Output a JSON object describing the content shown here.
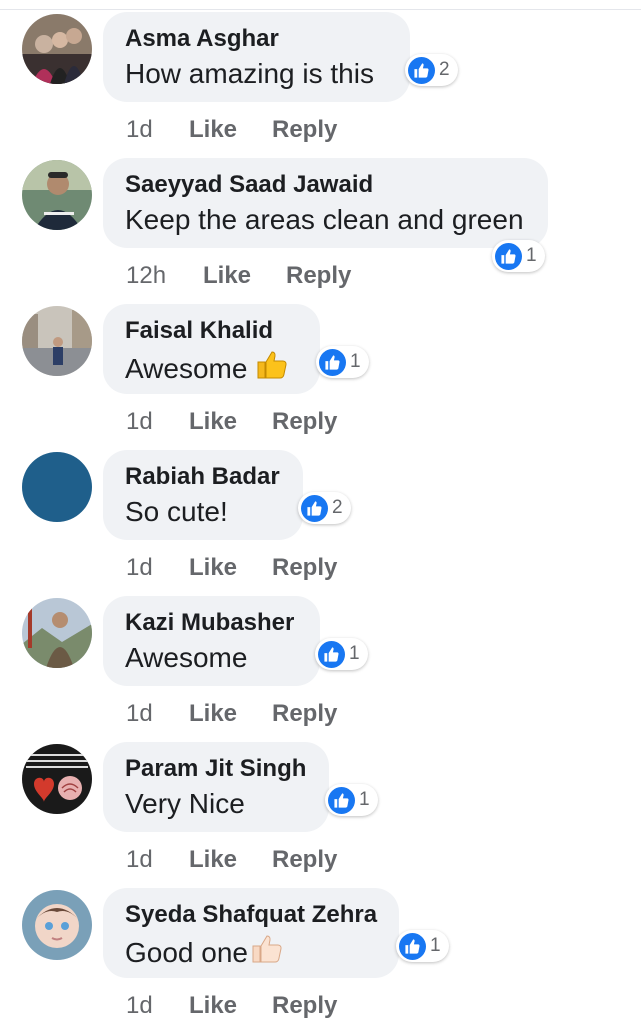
{
  "actions": {
    "like_label": "Like",
    "reply_label": "Reply"
  },
  "colors": {
    "like_badge": "#1877f2",
    "bubble": "#f0f2f5",
    "meta_text": "#65676b"
  },
  "comments": [
    {
      "author": "Asma Asghar",
      "text": "How amazing is this",
      "emoji": "",
      "time": "1d",
      "reaction_count": "2",
      "reaction_icon": "like-icon"
    },
    {
      "author": "Saeyyad Saad Jawaid",
      "text": "Keep the areas clean and green",
      "emoji": "",
      "time": "12h",
      "reaction_count": "1",
      "reaction_icon": "like-icon"
    },
    {
      "author": "Faisal Khalid",
      "text": "Awesome",
      "emoji": "thumbs-up",
      "time": "1d",
      "reaction_count": "1",
      "reaction_icon": "like-icon"
    },
    {
      "author": "Rabiah Badar",
      "text": "So cute!",
      "emoji": "",
      "time": "1d",
      "reaction_count": "2",
      "reaction_icon": "like-icon"
    },
    {
      "author": "Kazi Mubasher",
      "text": "Awesome",
      "emoji": "",
      "time": "1d",
      "reaction_count": "1",
      "reaction_icon": "like-icon"
    },
    {
      "author": "Param Jit Singh",
      "text": "Very Nice",
      "emoji": "",
      "time": "1d",
      "reaction_count": "1",
      "reaction_icon": "like-icon"
    },
    {
      "author": "Syeda Shafquat Zehra",
      "text": "Good one",
      "emoji": "thumbs-up-light",
      "time": "1d",
      "reaction_count": "1",
      "reaction_icon": "like-icon"
    }
  ]
}
